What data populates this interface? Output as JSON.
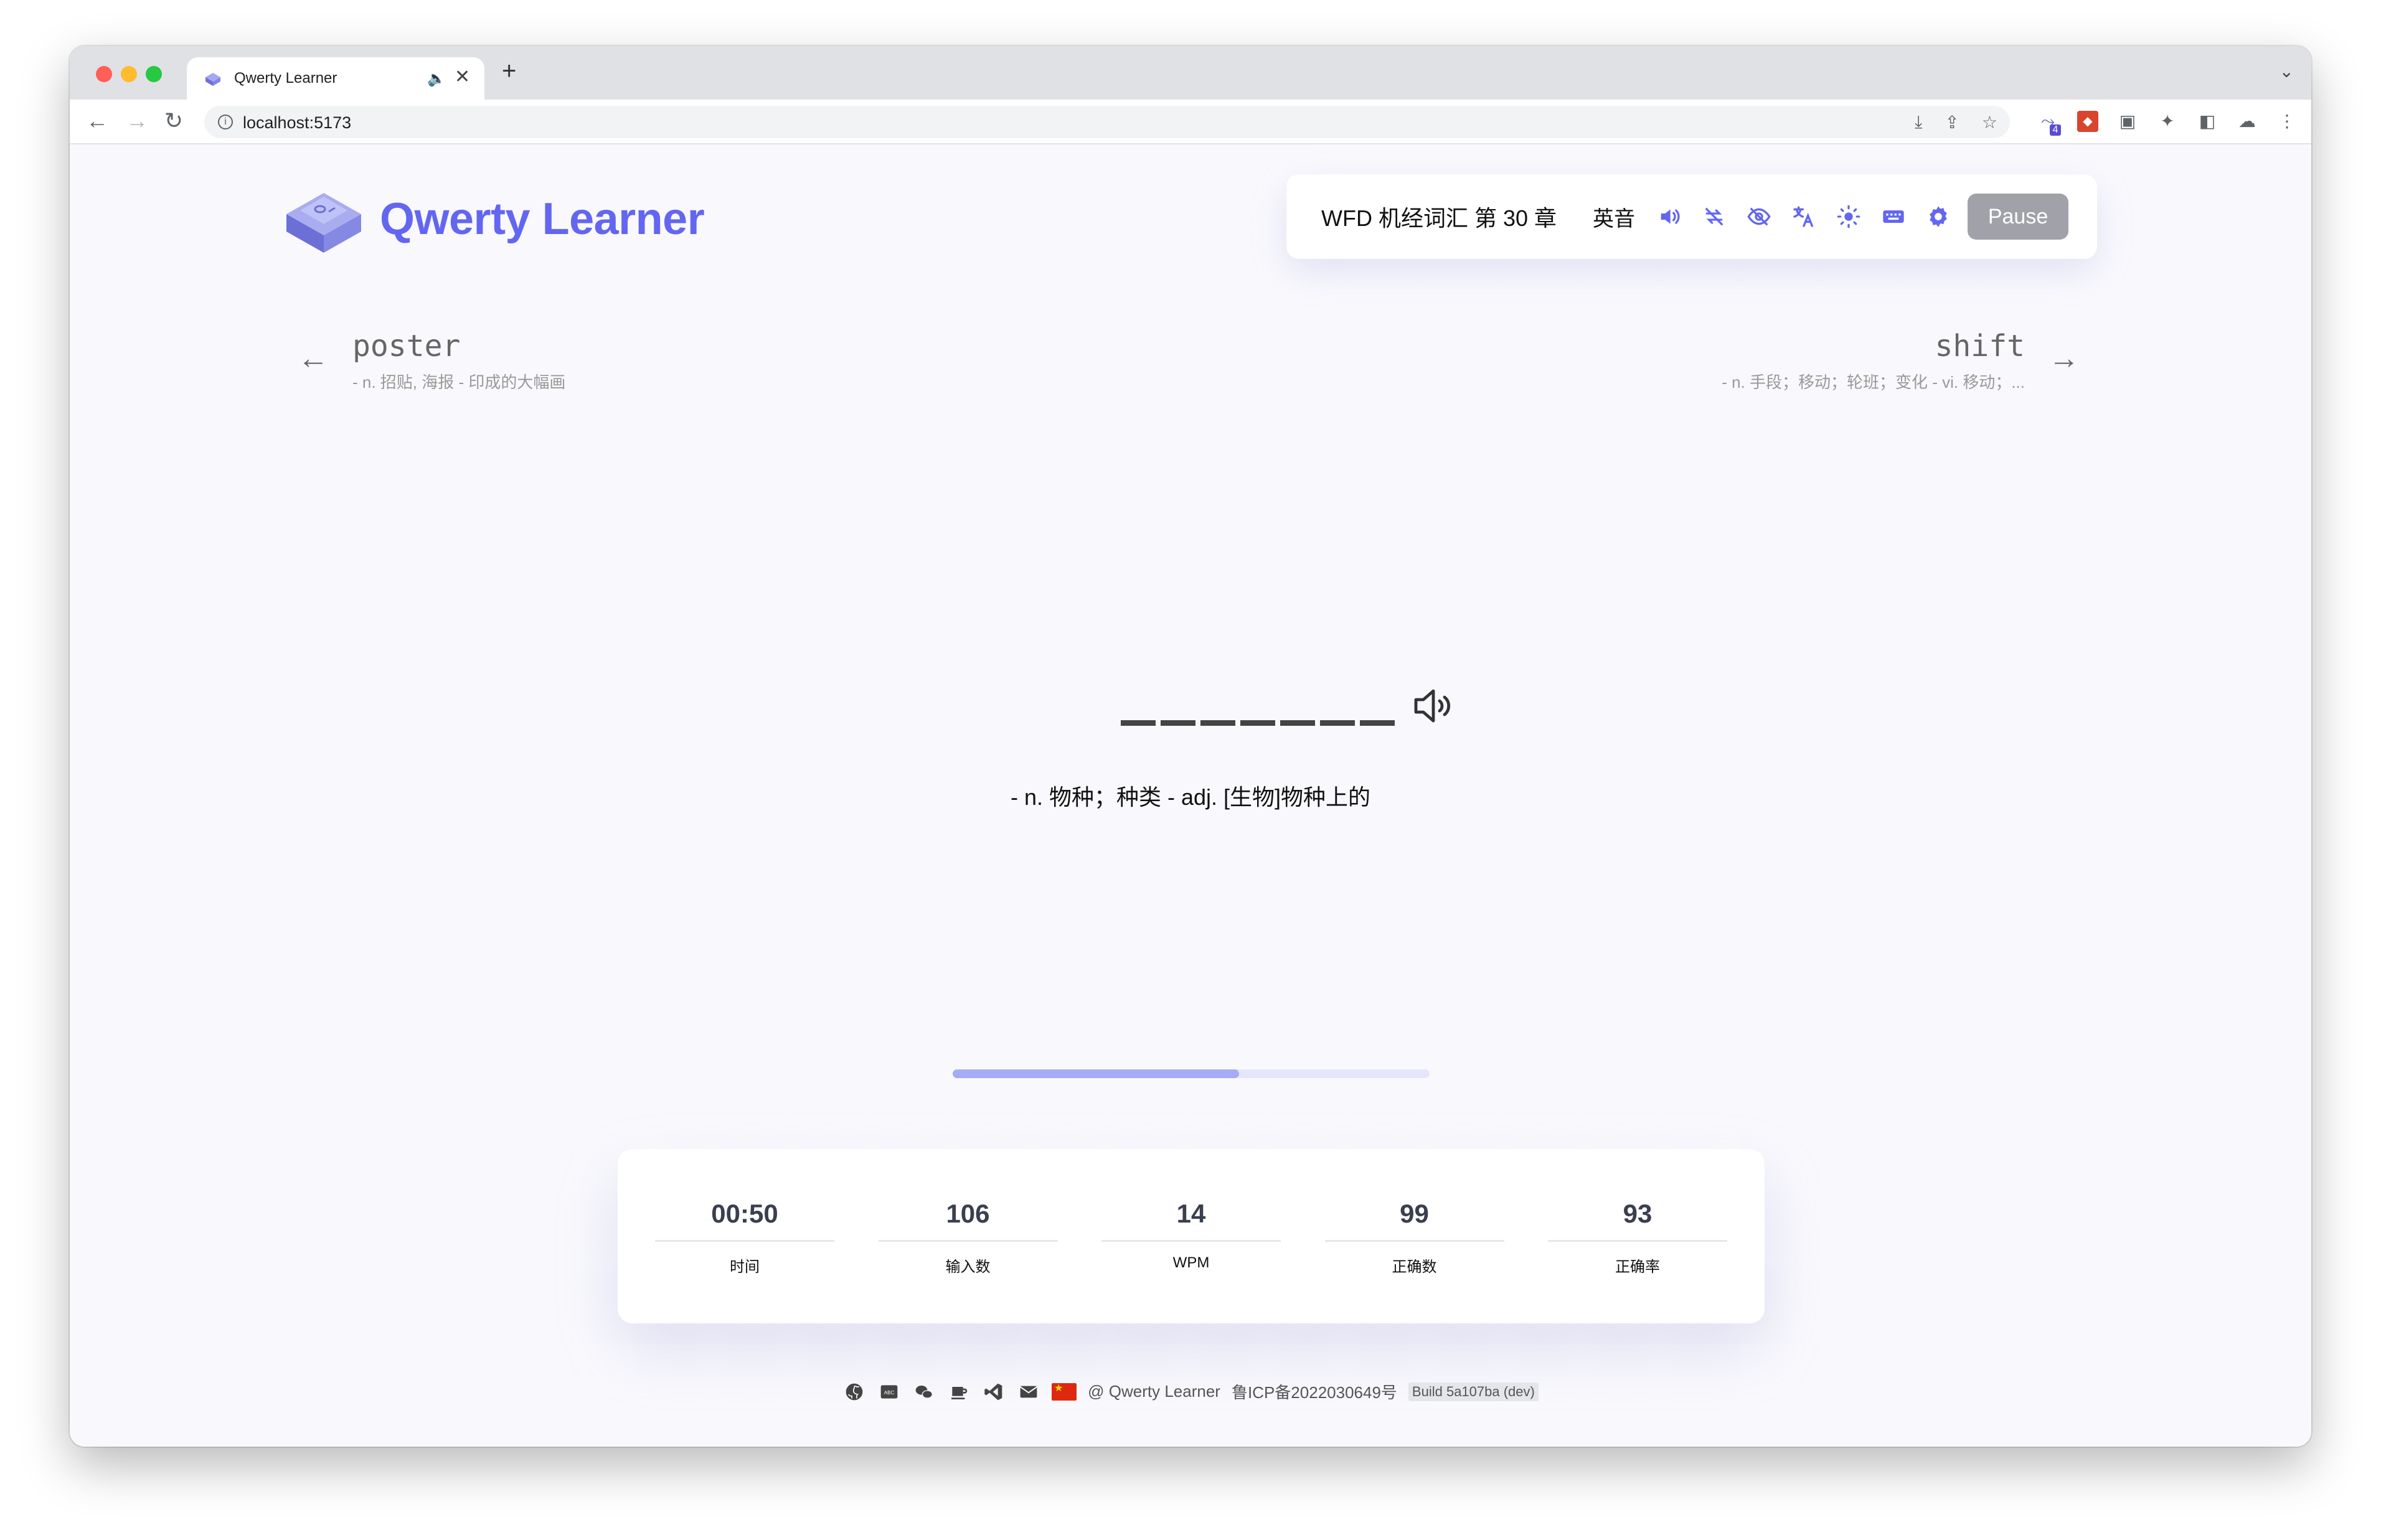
{
  "browser": {
    "tab_title": "Qwerty Learner",
    "tab_audio_icon": "speaker-icon",
    "tab_close": "✕",
    "new_tab": "+",
    "url": "localhost:5173",
    "extensions_badge": "4"
  },
  "header": {
    "logo_text": "Qwerty Learner",
    "dictionary": "WFD 机经词汇 第 30 章",
    "accent": "英音",
    "pause_label": "Pause",
    "accent_color": "#6366f1"
  },
  "prev_word": {
    "word": "poster",
    "translation": "- n. 招贴, 海报 - 印成的大幅画"
  },
  "next_word": {
    "word": "shift",
    "translation": "- n. 手段；移动；轮班；变化 - vi. 移动；..."
  },
  "current_word": {
    "letter_count": 7,
    "translation": "- n. 物种；种类 - adj. [生物]物种上的"
  },
  "progress": {
    "fraction": 0.6
  },
  "stats": [
    {
      "value": "00:50",
      "label": "时间"
    },
    {
      "value": "106",
      "label": "输入数"
    },
    {
      "value": "14",
      "label": "WPM"
    },
    {
      "value": "99",
      "label": "正确数"
    },
    {
      "value": "93",
      "label": "正确率"
    }
  ],
  "footer": {
    "copyright": "@ Qwerty Learner",
    "icp": "鲁ICP备2022030649号",
    "build": "Build 5a107ba (dev)"
  }
}
